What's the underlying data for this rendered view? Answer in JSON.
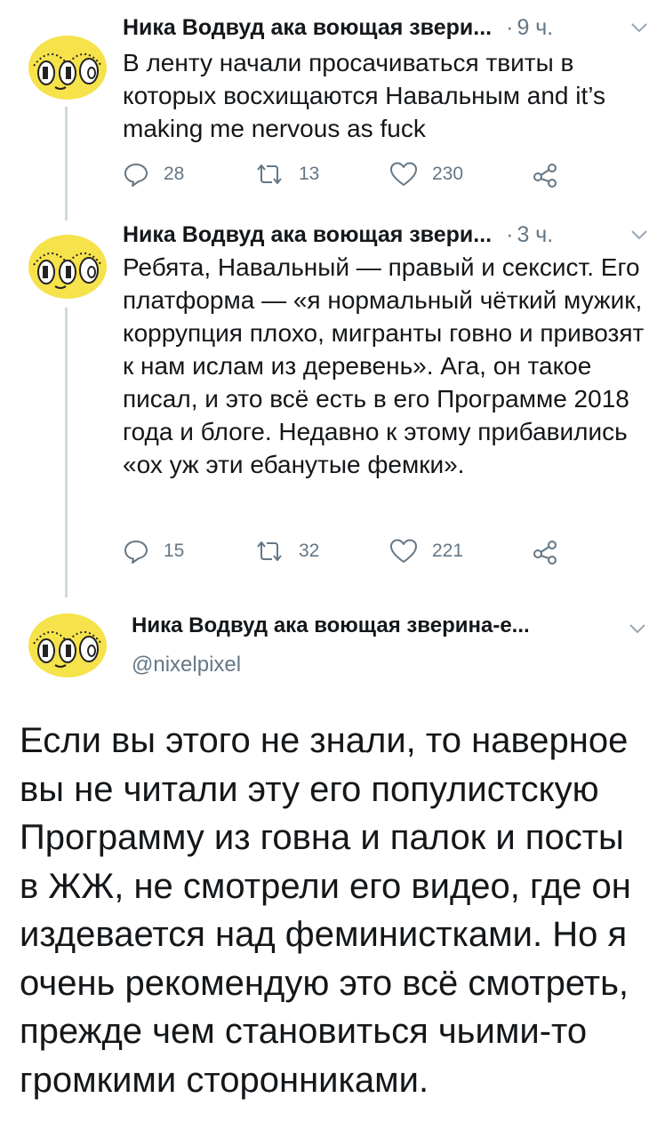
{
  "thread": [
    {
      "author": "Ника Водвуд ака воющая звери...",
      "time": "9 ч.",
      "text": "В ленту начали просачиваться твиты в которых восхищаются Навальным and it’s making me nervous as fuck",
      "replies": "28",
      "retweets": "13",
      "likes": "230"
    },
    {
      "author": "Ника Водвуд ака воющая звери...",
      "time": "3 ч.",
      "text": "Ребята, Навальный — правый и сексист. Его платформа — «я нормальный чёткий мужик, коррупция плохо, мигранты говно и привозят к нам ислам из деревень». Ага, он такое писал, и это всё есть в его Программе 2018 года и блоге. Недавно к этому прибавились «ох уж эти ебанутые фемки».",
      "replies": "15",
      "retweets": "32",
      "likes": "221"
    }
  ],
  "main_tweet": {
    "author": "Ника Водвуд ака воющая зверина-е...",
    "handle": "@nixelpixel",
    "text": "Если вы этого не знали, то наверное вы не читали эту его популистскую Программу из говна и палок и посты в ЖЖ, не смотрели его видео, где он издевается над феминистками. Но я очень рекомендую это всё смотреть, прежде чем становиться чьими-то громкими сторонниками."
  },
  "icons": {
    "reply": "reply-icon",
    "retweet": "retweet-icon",
    "like": "heart-icon",
    "share": "share-icon",
    "menu": "chevron-down-icon",
    "avatar": "avatar-eyes-illustration"
  },
  "colors": {
    "text": "#14171a",
    "secondary": "#657786",
    "thread_line": "#cfd9de",
    "avatar_yellow": "#f6e24a"
  }
}
